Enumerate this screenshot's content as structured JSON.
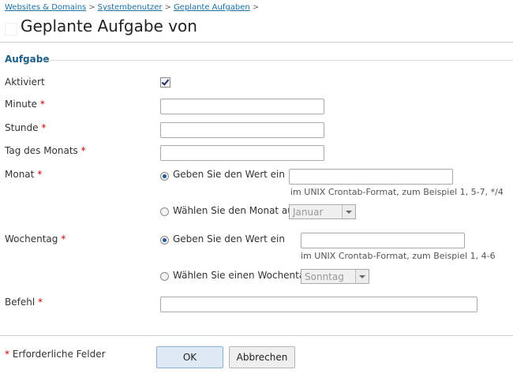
{
  "breadcrumb": {
    "items": [
      "Websites & Domains",
      "Systembenutzer",
      "Geplante Aufgaben"
    ],
    "separator": ">"
  },
  "page_title": "Geplante Aufgabe von",
  "section_title": "Aufgabe",
  "required_mark": "*",
  "fields": {
    "aktiviert": {
      "label": "Aktiviert",
      "checked": true
    },
    "minute": {
      "label": "Minute",
      "value": ""
    },
    "stunde": {
      "label": "Stunde",
      "value": ""
    },
    "tag": {
      "label": "Tag des Monats",
      "value": ""
    },
    "monat": {
      "label": "Monat",
      "option_value_label": "Geben Sie den Wert ein",
      "value": "",
      "hint": "im UNIX Crontab-Format, zum Beispiel 1, 5-7, */4",
      "option_select_label": "Wählen Sie den Monat aus",
      "select_value": "Januar"
    },
    "wochentag": {
      "label": "Wochentag",
      "option_value_label": "Geben Sie den Wert ein",
      "value": "",
      "hint": "im UNIX Crontab-Format, zum Beispiel 1, 4-6",
      "option_select_label": "Wählen Sie einen Wochentag aus",
      "select_value": "Sonntag"
    },
    "befehl": {
      "label": "Befehl",
      "value": ""
    }
  },
  "footer": {
    "required_note": "Erforderliche Felder",
    "ok_label": "OK",
    "cancel_label": "Abbrechen"
  },
  "colors": {
    "link": "#1a6fa3",
    "section_title": "#1f5e85",
    "required": "#cc0000",
    "ok_button_bg": "#dfe9f3"
  }
}
